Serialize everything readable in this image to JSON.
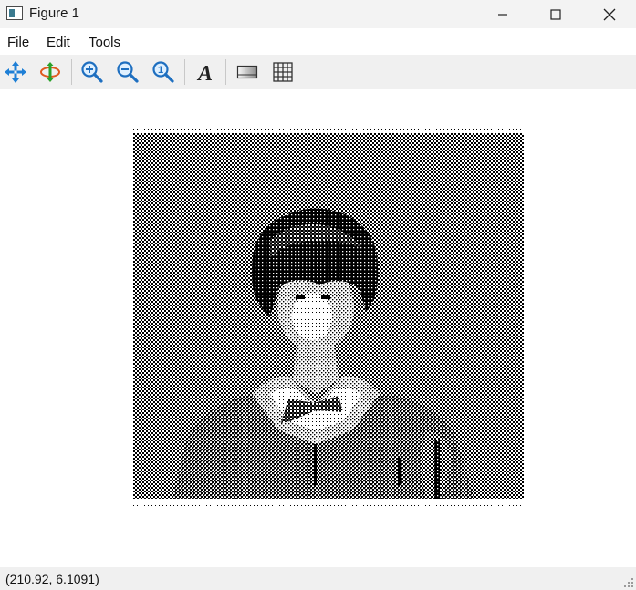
{
  "window": {
    "title": "Figure 1",
    "app_icon": "figure-window-icon",
    "controls": [
      "minimize-icon",
      "maximize-icon",
      "close-icon"
    ]
  },
  "menu": {
    "items": [
      "File",
      "Edit",
      "Tools"
    ]
  },
  "toolbar": {
    "tools": [
      {
        "name": "pan-icon",
        "tooltip": "Pan"
      },
      {
        "name": "rotate-icon",
        "tooltip": "Rotate"
      },
      {
        "name": "zoom-in-icon",
        "tooltip": "Zoom in"
      },
      {
        "name": "zoom-out-icon",
        "tooltip": "Zoom out"
      },
      {
        "name": "zoom-reset-icon",
        "tooltip": "Reset zoom"
      },
      {
        "name": "text-icon",
        "tooltip": "Insert text"
      },
      {
        "name": "colorbar-icon",
        "tooltip": "Colorbar"
      },
      {
        "name": "grid-icon",
        "tooltip": "Grid"
      }
    ]
  },
  "figure": {
    "content": "halftone dithered grayscale image of a seated person",
    "colors": {
      "dark": "#000000",
      "light": "#ffffff"
    }
  },
  "status": {
    "coordinates": "(210.92, 6.1091)"
  }
}
